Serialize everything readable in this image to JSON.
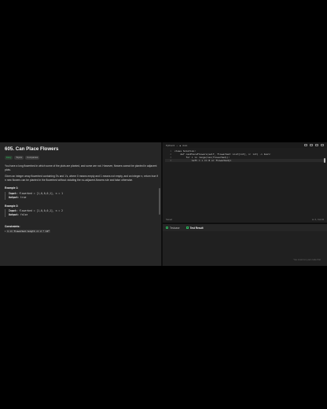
{
  "problem": {
    "title": "605. Can Place Flowers",
    "tags": [
      "Easy",
      "Topics",
      "Companies"
    ],
    "para1": "You have a long flowerbed in which some of the plots are planted, and some are not. However, flowers cannot be planted in adjacent plots.",
    "para2": "Given an integer array flowerbed containing 0's and 1's, where 0 means empty and 1 means not empty, and an integer n, return true if n new flowers can be planted in the flowerbed without violating the no-adjacent-flowers rule and false otherwise.",
    "example1": {
      "title": "Example 1:",
      "input_label": "Input:",
      "input": "flowerbed = [1,0,0,0,1], n = 1",
      "output_label": "Output:",
      "output": "true"
    },
    "example2": {
      "title": "Example 2:",
      "input_label": "Input:",
      "input": "flowerbed = [1,0,0,0,1], n = 2",
      "output_label": "Output:",
      "output": "false"
    },
    "constraints_title": "Constraints:",
    "constraint1": "1 <= flowerbed.length <= 2 * 10⁴"
  },
  "editor": {
    "language": "Python3",
    "mode": "Auto",
    "lines": [
      {
        "n": "1",
        "text": "class Solution:"
      },
      {
        "n": "2",
        "text": "    def canPlaceFlowers(self, flowerbed: List[int], n: int) -> bool:"
      },
      {
        "n": "3",
        "text": "        for i in range(len(flowerbed)):"
      },
      {
        "n": "4",
        "text": "            left = i == 0 or flowerbed[i"
      }
    ],
    "saved": "Saved",
    "position": "Ln 4, Col 43"
  },
  "results": {
    "tab1": "Testcase",
    "tab2": "Test Result",
    "hint": "You must run your code first"
  }
}
